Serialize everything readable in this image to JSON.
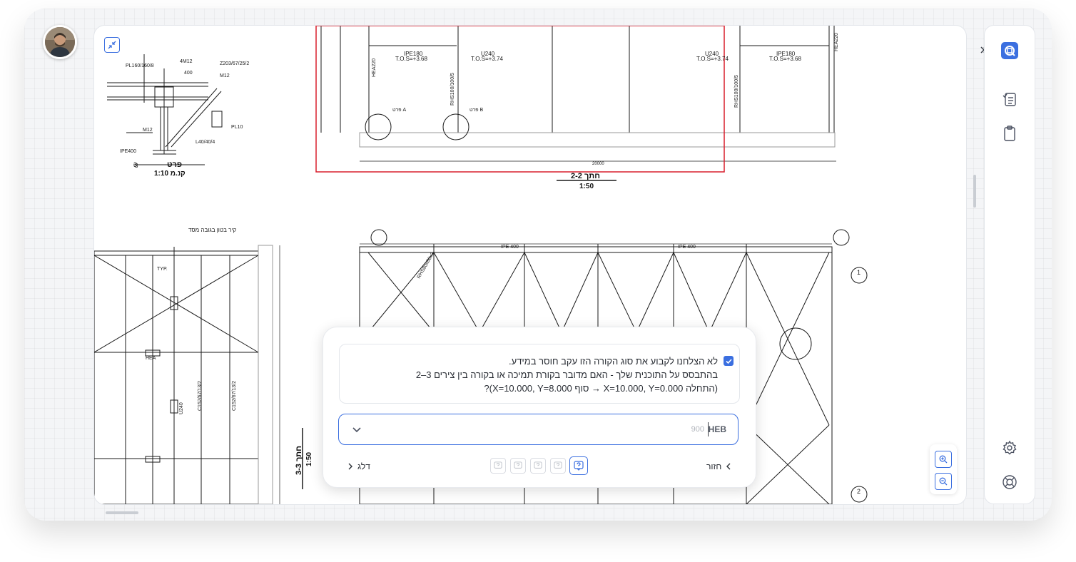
{
  "drawing": {
    "detail_title": "פרט",
    "detail_scale": "קנ.מ 1:10",
    "detail_number": "3",
    "section_2_title": "חתך 2-2",
    "section_2_scale": "1:50",
    "section_3_title": "חתך 3-3",
    "section_3_scale": "1:50",
    "labels": {
      "pl160": "PL160/160/8",
      "z203": "Z203/67/25/2",
      "m12a": "4M12",
      "m12b": "M12",
      "m12c": "M12",
      "dim400": "400",
      "ipe400": "IPE400",
      "l40": "L40/40/4",
      "pl10": "PL10",
      "ipe180a": "IPE180",
      "tos368a": "T.O.S=+3.68",
      "u240a": "U240",
      "tos374a": "T.O.S=+3.74",
      "u240b": "U240",
      "tos374b": "T.O.S=+3.74",
      "ipe180b": "IPE180",
      "tos368b": "T.O.S=+3.68",
      "hea220a": "HEA220",
      "hea220b": "HEA220",
      "rhs100a": "RHS100/100/5",
      "rhs100b": "RHS100/100/5",
      "detA": "פרט A",
      "detB": "פרט B",
      "typ": "TYP.",
      "dim20000": "20000",
      "wall_note": "קיר בטון בגובה מסד",
      "u240v": "U240",
      "c152a": "C152/67/13/2",
      "c152b": "C152/67/13/2",
      "hea": "HEA",
      "ipe400a": "IPE 400",
      "ipe400b": "IPE 400",
      "rhs80": "RHS80x80x3",
      "grid1": "1",
      "grid2": "2",
      "grid3": "3"
    }
  },
  "dialog": {
    "question_line1": "לא הצלחנו לקבוע את סוג הקורה הזו עקב חוסר במידע.",
    "question_line2": "בהתבסס על התוכנית שלך - האם מדובר בקורת תמיכה או בקורה בין צירים 3–2",
    "question_line3": "(התחלה X=10.000, Y=0.000 → סוף X=10.000, Y=8.000)?",
    "input_lang": "HEB",
    "input_counter": "900",
    "back_label": "חזור",
    "skip_label": "דלג"
  },
  "colors": {
    "accent": "#3b6fe0",
    "highlight_rect": "#d81e2c"
  },
  "icons": {
    "collapse": "collapse-arrows-icon",
    "expand": "double-chevron-right-icon",
    "logo": "app-logo-icon",
    "checklist": "checklist-icon",
    "clipboard": "clipboard-icon",
    "settings": "gear-icon",
    "help": "lifebuoy-icon",
    "zoom_in": "zoom-in-icon",
    "zoom_out": "zoom-out-icon"
  }
}
